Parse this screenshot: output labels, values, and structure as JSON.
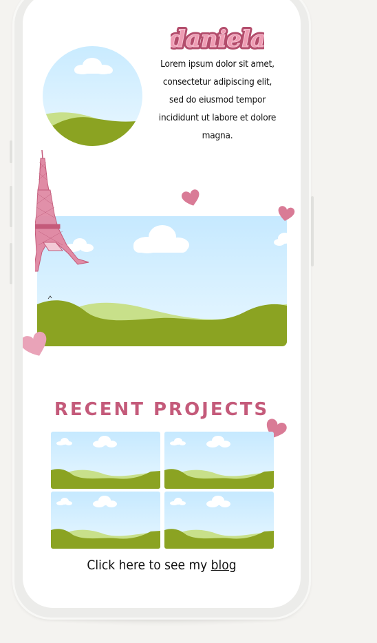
{
  "profile": {
    "name": "daniela",
    "bio": "Lorem ipsum dolor sit amet, consectetur adipiscing elit, sed do eiusmod tempor incididunt ut labore et dolore magna."
  },
  "projects": {
    "title": "RECENT PROJECTS",
    "items": [
      {
        "icon": "landscape-thumbnail"
      },
      {
        "icon": "landscape-thumbnail"
      },
      {
        "icon": "landscape-thumbnail"
      },
      {
        "icon": "landscape-thumbnail"
      }
    ]
  },
  "footer": {
    "blog_prefix": "Click here to see my",
    "blog_link": "blog"
  },
  "colors": {
    "accent": "#c45a7a",
    "heart": "#d97b96",
    "sky_top": "#c9ebff",
    "hill_dark": "#8ba322",
    "hill_light": "#c8e08a"
  },
  "decorations": [
    "eiffel-tower-icon",
    "heart-icon",
    "cloud-icon"
  ]
}
